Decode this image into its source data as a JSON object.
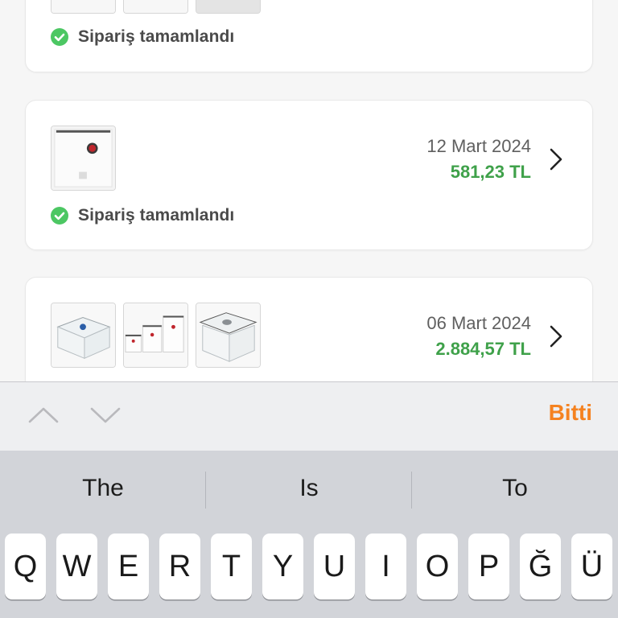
{
  "orders": [
    {
      "id": "order-1",
      "status": "Sipariş tamamlandı",
      "thumbnails": [
        "partial-thumb-1",
        "partial-thumb-2",
        "partial-thumb-3"
      ]
    },
    {
      "id": "order-2",
      "date": "12 Mart 2024",
      "price": "581,23 TL",
      "status": "Sipariş tamamlandı",
      "thumbnails": [
        "vacuum-bag"
      ]
    },
    {
      "id": "order-3",
      "date": "06 Mart 2024",
      "price": "2.884,57 TL",
      "thumbnails": [
        "storage-container",
        "vacuum-bag-set",
        "glass-container"
      ]
    }
  ],
  "accessory_bar": {
    "prev_icon": "chevron-up-icon",
    "next_icon": "chevron-down-icon",
    "done_label": "Bitti",
    "done_color": "#f58220"
  },
  "keyboard": {
    "suggestions": [
      "The",
      "Is",
      "To"
    ],
    "top_row": [
      "Q",
      "W",
      "E",
      "R",
      "T",
      "Y",
      "U",
      "I",
      "O",
      "P",
      "Ğ",
      "Ü"
    ]
  },
  "colors": {
    "price_green": "#3fa14a",
    "status_check_green": "#4cc763"
  }
}
